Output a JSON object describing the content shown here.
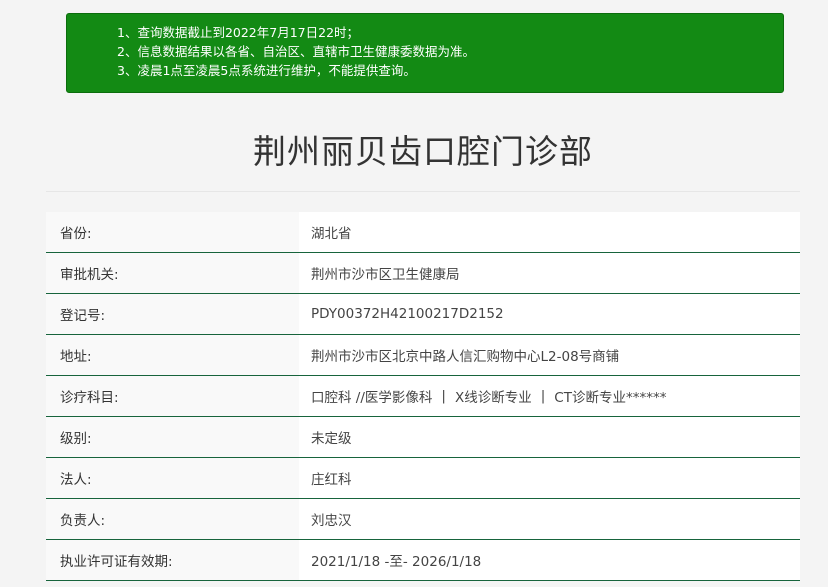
{
  "notice": {
    "lines": [
      "1、查询数据截止到2022年7月17日22时；",
      "2、信息数据结果以各省、自治区、直辖市卫生健康委数据为准。",
      "3、凌晨1点至凌晨5点系统进行维护，不能提供查询。"
    ]
  },
  "title": "荆州丽贝齿口腔门诊部",
  "rows": [
    {
      "label": "省份:",
      "value": "湖北省"
    },
    {
      "label": "审批机关:",
      "value": "荆州市沙市区卫生健康局"
    },
    {
      "label": "登记号:",
      "value": "PDY00372H42100217D2152"
    },
    {
      "label": "地址:",
      "value": "荆州市沙市区北京中路人信汇购物中心L2-08号商铺"
    },
    {
      "label": "诊疗科目:",
      "value_parts": [
        "口腔科 //医学影像科",
        "X线诊断专业",
        "CT诊断专业******"
      ],
      "separator": "|"
    },
    {
      "label": "级别:",
      "value": "未定级"
    },
    {
      "label": "法人:",
      "value": "庄红科"
    },
    {
      "label": "负责人:",
      "value": "刘忠汉"
    },
    {
      "label": "执业许可证有效期:",
      "value": "2021/1/18 -至- 2026/1/18"
    }
  ]
}
